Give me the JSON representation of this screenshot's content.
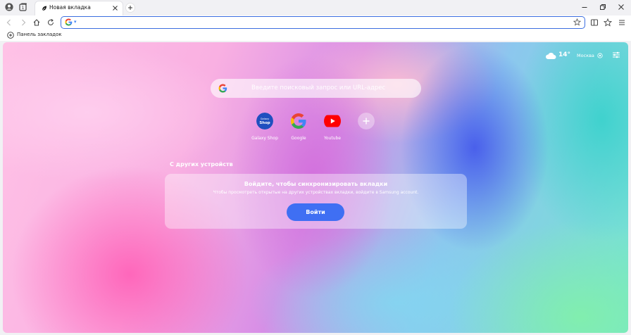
{
  "tab": {
    "title": "Новая вкладка"
  },
  "omnibox": {
    "value": ""
  },
  "bookmarks_bar": {
    "label": "Панель закладок"
  },
  "weather": {
    "temperature": "14°",
    "city": "Москва",
    "icon": "cloud-icon"
  },
  "search": {
    "placeholder": "Введите поисковый запрос или URL-адрес"
  },
  "shortcuts": [
    {
      "label": "Galaxy Shop",
      "tile_text": "Galaxy Shop",
      "color": "#1f4fbf"
    },
    {
      "label": "Google",
      "color": "#ffffff"
    },
    {
      "label": "Youtube",
      "color": "#ff0000"
    },
    {
      "label": "",
      "color": "#ffffff"
    }
  ],
  "sync": {
    "section_title": "С других устройств",
    "heading": "Войдите, чтобы синхронизировать вкладки",
    "description": "Чтобы просмотреть открытые на других устройствах вкладки, войдите в Samsung account.",
    "button_label": "Войти"
  },
  "colors": {
    "accent": "#3b6ee0",
    "button": "#3f6ff3"
  }
}
